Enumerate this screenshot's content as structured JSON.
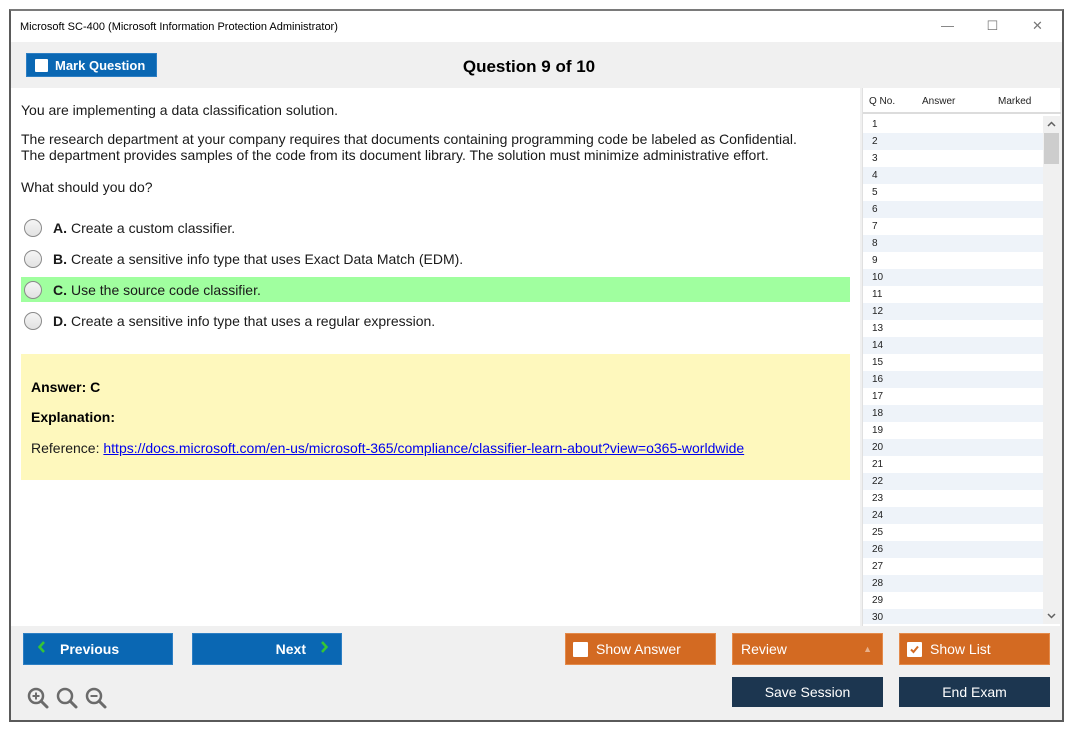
{
  "window": {
    "title": "Microsoft SC-400 (Microsoft Information Protection Administrator)",
    "controls": {
      "minimize": "—",
      "maximize": "☐",
      "close": "✕"
    }
  },
  "header": {
    "mark_question_label": "Mark Question",
    "mark_question_checked": false,
    "question_heading": "Question 9 of 10"
  },
  "question": {
    "paragraphs": [
      "You are implementing a data classification solution.",
      "The research department at your company requires that documents containing programming code be labeled as Confidential.",
      "The department provides samples of the code from its document library. The solution must minimize administrative effort.",
      "What should you do?"
    ],
    "options": [
      {
        "letter": "A.",
        "text": "Create a custom classifier.",
        "correct": false
      },
      {
        "letter": "B.",
        "text": "Create a sensitive info type that uses Exact Data Match (EDM).",
        "correct": false
      },
      {
        "letter": "C.",
        "text": "Use the source code classifier.",
        "correct": true
      },
      {
        "letter": "D.",
        "text": "Create a sensitive info type that uses a regular expression.",
        "correct": false
      }
    ]
  },
  "answer": {
    "answer_label": "Answer: C",
    "explanation_label": "Explanation:",
    "reference_prefix": "Reference: ",
    "reference_link": "https://docs.microsoft.com/en-us/microsoft-365/compliance/classifier-learn-about?view=o365-worldwide"
  },
  "question_list": {
    "headers": {
      "number": "Q No.",
      "answer": "Answer",
      "marked": "Marked"
    },
    "rows": [
      "1",
      "2",
      "3",
      "4",
      "5",
      "6",
      "7",
      "8",
      "9",
      "10",
      "11",
      "12",
      "13",
      "14",
      "15",
      "16",
      "17",
      "18",
      "19",
      "20",
      "21",
      "22",
      "23",
      "24",
      "25",
      "26",
      "27",
      "28",
      "29",
      "30"
    ],
    "scroll_up": "^",
    "scroll_down": "v"
  },
  "footer": {
    "previous_label": "Previous",
    "next_label": "Next",
    "show_answer_label": "Show Answer",
    "show_answer_checked": false,
    "review_label": "Review",
    "show_list_label": "Show List",
    "show_list_checked": true,
    "save_session_label": "Save Session",
    "end_exam_label": "End Exam",
    "chevron_left": "<",
    "chevron_right": ">",
    "review_arrow": "▲"
  },
  "colors": {
    "primary_blue": "#0a67b3",
    "orange": "#d36a22",
    "dark_navy": "#1c3650",
    "correct_green": "#a0ff9f",
    "answer_yellow": "#fef8bd",
    "chevron_green": "#35c535"
  }
}
